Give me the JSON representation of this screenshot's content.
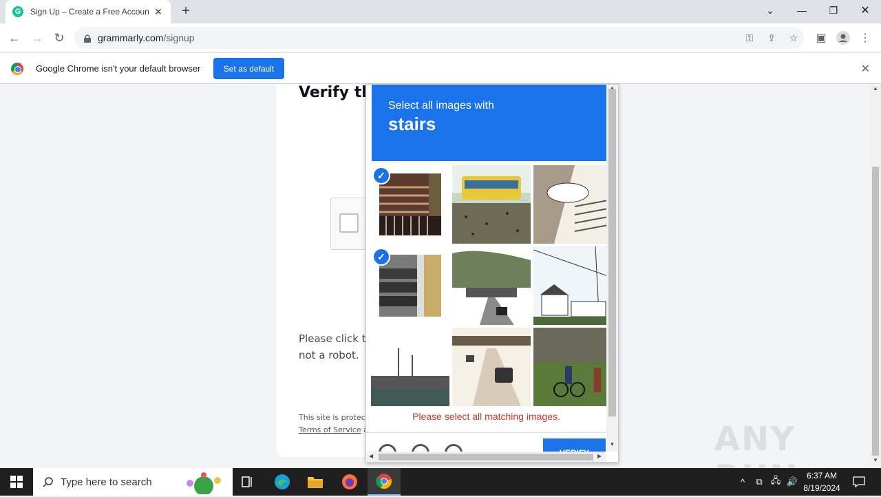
{
  "browser": {
    "tab_title": "Sign Up – Create a Free Account",
    "tab_favicon_letter": "G",
    "url_domain": "grammarly.com",
    "url_path": "/signup"
  },
  "infobar": {
    "message": "Google Chrome isn't your default browser",
    "set_default_label": "Set as default"
  },
  "page": {
    "heading": "Verify tha",
    "instruction": "Please click th\nnot a robot.",
    "instruction_line1": "Please click th",
    "instruction_line2": "not a robot.",
    "protected_line1": "This site is protec",
    "terms_link": "Terms of Service",
    "terms_suffix": " a"
  },
  "challenge": {
    "prompt_line1": "Select all images with",
    "prompt_target": "stairs",
    "error": "Please select all matching images.",
    "verify_label": "VERIFY",
    "tiles": [
      {
        "name": "tile-1",
        "selected": true,
        "desc": "stairs-railing"
      },
      {
        "name": "tile-2",
        "selected": false,
        "desc": "bus"
      },
      {
        "name": "tile-3",
        "selected": false,
        "desc": "outdoor-stairs"
      },
      {
        "name": "tile-4",
        "selected": true,
        "desc": "stone-steps"
      },
      {
        "name": "tile-5",
        "selected": false,
        "desc": "road-bridge"
      },
      {
        "name": "tile-6",
        "selected": false,
        "desc": "houses"
      },
      {
        "name": "tile-7",
        "selected": false,
        "desc": "harbor"
      },
      {
        "name": "tile-8",
        "selected": false,
        "desc": "highway-cars"
      },
      {
        "name": "tile-9",
        "selected": false,
        "desc": "cyclists"
      }
    ]
  },
  "watermark": "ANY RUN",
  "taskbar": {
    "search_placeholder": "Type here to search",
    "time": "6:37 AM",
    "date": "8/19/2024"
  },
  "colors": {
    "accent": "#1a73e8",
    "error": "#d93025",
    "taskbar": "#1f1f1f"
  }
}
